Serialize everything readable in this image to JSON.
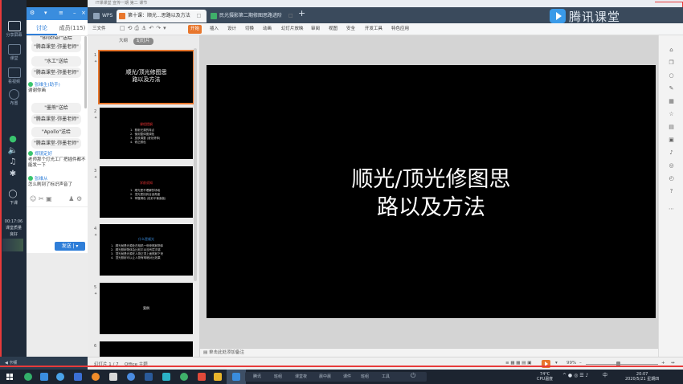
{
  "os_title": "IT课课堂 宣传一期 第二 课节",
  "live_rail": {
    "share_label": "分享屏幕",
    "items": [
      "",
      "课堂",
      "看视频",
      "布置"
    ],
    "end_label": "下课",
    "timer": "00:17:06",
    "quality_label": "课堂质量",
    "quality_value": "良好"
  },
  "chat": {
    "tabs": [
      "讨论",
      "成员(115)"
    ],
    "messages": [
      {
        "type": "bubble",
        "text": "\"Brother\"送给"
      },
      {
        "type": "bubble",
        "text": "\"腾森课堂-弥墨老师\""
      },
      {
        "type": "bubble",
        "text": "\"水工\"送给"
      },
      {
        "type": "bubble",
        "text": "\"腾森课堂-弥墨老师\""
      },
      {
        "type": "sys",
        "name": "张维生(助手)",
        "text": "谢谢你画"
      },
      {
        "type": "bubble",
        "text": "\"墨熊\"送给"
      },
      {
        "type": "bubble",
        "text": "\"腾森课堂-弥墨老师\""
      },
      {
        "type": "bubble",
        "text": "\"Apollo\"送给"
      },
      {
        "type": "bubble",
        "text": "\"腾森课堂-弥墨老师\""
      },
      {
        "type": "sys",
        "name": "郑镜定好",
        "text": "老师那个灯光工厂把插件都不能发一下"
      },
      {
        "type": "sys",
        "name": "张维从",
        "text": "怎么刷到了标识声音了"
      }
    ],
    "send_label": "发送"
  },
  "wps": {
    "tabs": [
      {
        "label": "WPS",
        "color": "#5b6c80"
      },
      {
        "label": "第十课：顺光...思路以及方法",
        "color": "#e8762c"
      },
      {
        "label": "民光摄影第二期修图思路进阶",
        "color": "#3fb06a"
      }
    ],
    "brand": "腾讯课堂"
  },
  "ribbon": {
    "file": "三文件",
    "start": "开始",
    "menus": [
      "插入",
      "设计",
      "切换",
      "动画",
      "幻灯片放映",
      "审阅",
      "视图",
      "安全",
      "开发工具",
      "特色应用"
    ]
  },
  "slides_pane": {
    "tab_outline": "大纲",
    "tab_slides": "幻灯片",
    "slides": [
      {
        "num": "1",
        "title": "顺光/顶光修图思\n路以及方法"
      },
      {
        "num": "2",
        "red": "课程提纲",
        "lines": "1.  照射光源的特点\n2.  使用整体图调色\n3.  皮肤调整 (液化修饰)\n4.  修正颜色"
      },
      {
        "num": "3",
        "red": "学前须知",
        "lines": "1.  顺光是不理解的场地\n2.  顶光是找到合适角度\n3.  掌握调色 (色彩平衡面板)"
      },
      {
        "num": "4",
        "blue": "什么是顺光",
        "lines": "1.  顺光就是光源处在相机一侧来照射物体\n2.  顺光照射物体会比较平淡没有层次感\n3.  顶光就是光源在人物正顶上面照射下来\n4.  顶光照射可以让人物有明暗对比效果"
      },
      {
        "num": "5",
        "center": "案例"
      },
      {
        "num": "6"
      }
    ]
  },
  "slide": {
    "title_line1": "顺光/顶光修图思",
    "title_line2": "路以及方法"
  },
  "notes_placeholder": "单击此处添加备注",
  "status": {
    "page": "幻灯片 1 / 7",
    "theme": "Office 主题",
    "zoom": "99%"
  },
  "taskbar": {
    "group_items": [
      "腾讯",
      "班组",
      "课堂夜",
      "晨中晨",
      "课件",
      "班组",
      "工具"
    ],
    "temp": "74°C",
    "cpu": "CPU温度",
    "time": "20:07",
    "date": "2020/5/21 星期四",
    "ime": "中"
  }
}
